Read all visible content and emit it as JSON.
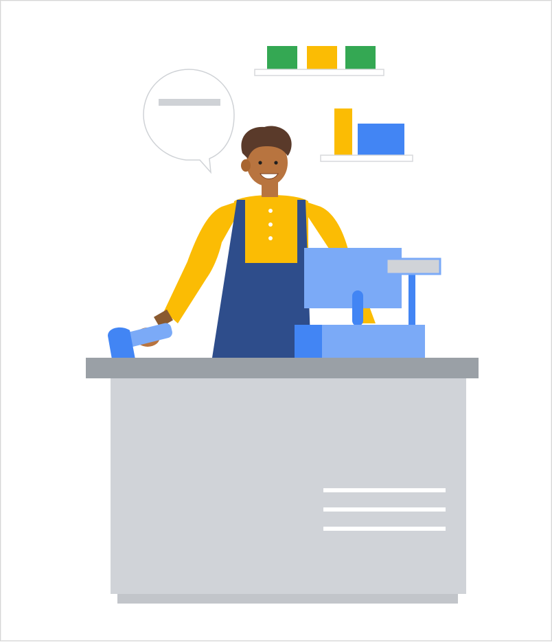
{
  "illustration": {
    "alt_subject": "",
    "palette": {
      "green": "#34a853",
      "yellow": "#fbbc04",
      "blue": "#4285f4",
      "light_blue": "#7baaf7",
      "navy": "#2e4d8b",
      "counter_top": "#9aa0a6",
      "counter_body": "#d0d3d8",
      "shelf": "#ffffff",
      "skin": "#b8743f",
      "hair": "#5a3a2a",
      "bubble_line": "#cfd2d6"
    },
    "icons": [
      "speech-bubble-icon",
      "shelf-icon",
      "cashier-icon",
      "barcode-scanner-icon",
      "cash-register-icon",
      "counter-icon"
    ]
  }
}
